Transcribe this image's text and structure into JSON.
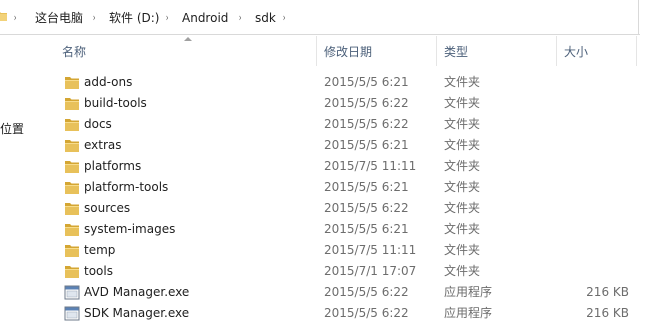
{
  "address": {
    "crumbs": [
      "这台电脑",
      "软件 (D:)",
      "Android",
      "sdk"
    ],
    "separator": "›"
  },
  "nav": {
    "partial_label": "位置"
  },
  "columns": {
    "name": "名称",
    "date": "修改日期",
    "type": "类型",
    "size": "大小"
  },
  "files": [
    {
      "name": "add-ons",
      "date": "2015/5/5 6:21",
      "type": "文件夹",
      "size": "",
      "icon": "folder-icon"
    },
    {
      "name": "build-tools",
      "date": "2015/5/5 6:22",
      "type": "文件夹",
      "size": "",
      "icon": "folder-icon"
    },
    {
      "name": "docs",
      "date": "2015/5/5 6:22",
      "type": "文件夹",
      "size": "",
      "icon": "folder-icon"
    },
    {
      "name": "extras",
      "date": "2015/5/5 6:21",
      "type": "文件夹",
      "size": "",
      "icon": "folder-icon"
    },
    {
      "name": "platforms",
      "date": "2015/7/5 11:11",
      "type": "文件夹",
      "size": "",
      "icon": "folder-icon"
    },
    {
      "name": "platform-tools",
      "date": "2015/5/5 6:21",
      "type": "文件夹",
      "size": "",
      "icon": "folder-icon"
    },
    {
      "name": "sources",
      "date": "2015/5/5 6:22",
      "type": "文件夹",
      "size": "",
      "icon": "folder-icon"
    },
    {
      "name": "system-images",
      "date": "2015/5/5 6:21",
      "type": "文件夹",
      "size": "",
      "icon": "folder-icon"
    },
    {
      "name": "temp",
      "date": "2015/7/5 11:11",
      "type": "文件夹",
      "size": "",
      "icon": "folder-icon"
    },
    {
      "name": "tools",
      "date": "2015/7/1 17:07",
      "type": "文件夹",
      "size": "",
      "icon": "folder-icon"
    },
    {
      "name": "AVD Manager.exe",
      "date": "2015/5/5 6:22",
      "type": "应用程序",
      "size": "216 KB",
      "icon": "exe-icon"
    },
    {
      "name": "SDK Manager.exe",
      "date": "2015/5/5 6:22",
      "type": "应用程序",
      "size": "216 KB",
      "icon": "exe-icon"
    }
  ],
  "colors": {
    "folder": "#e8c15a",
    "folder_dark": "#d4a633",
    "header_text": "#4c607a",
    "secondary_text": "#6d6d6d"
  }
}
